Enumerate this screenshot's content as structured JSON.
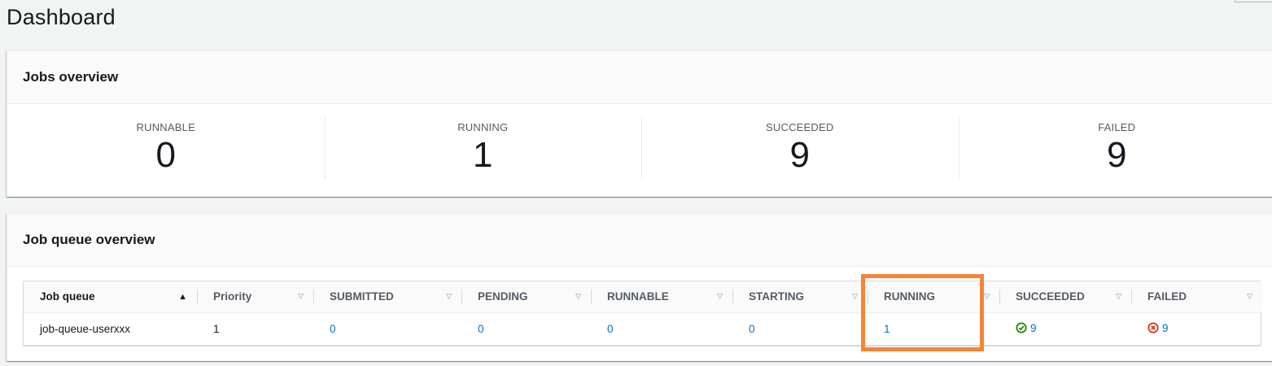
{
  "page": {
    "title": "Dashboard"
  },
  "jobs_overview": {
    "title": "Jobs overview",
    "stats": [
      {
        "label": "RUNNABLE",
        "value": "0"
      },
      {
        "label": "RUNNING",
        "value": "1"
      },
      {
        "label": "SUCCEEDED",
        "value": "9"
      },
      {
        "label": "FAILED",
        "value": "9"
      }
    ]
  },
  "job_queue_overview": {
    "title": "Job queue overview",
    "columns": [
      "Job queue",
      "Priority",
      "SUBMITTED",
      "PENDING",
      "RUNNABLE",
      "STARTING",
      "RUNNING",
      "SUCCEEDED",
      "FAILED"
    ],
    "rows": [
      {
        "job_queue": "job-queue-userxxx",
        "priority": "1",
        "submitted": "0",
        "pending": "0",
        "runnable": "0",
        "starting": "0",
        "running": "1",
        "succeeded": "9",
        "failed": "9"
      }
    ]
  },
  "colors": {
    "highlight": "#f58534",
    "link": "#0073bb",
    "success": "#1d8102",
    "error": "#d13212"
  }
}
